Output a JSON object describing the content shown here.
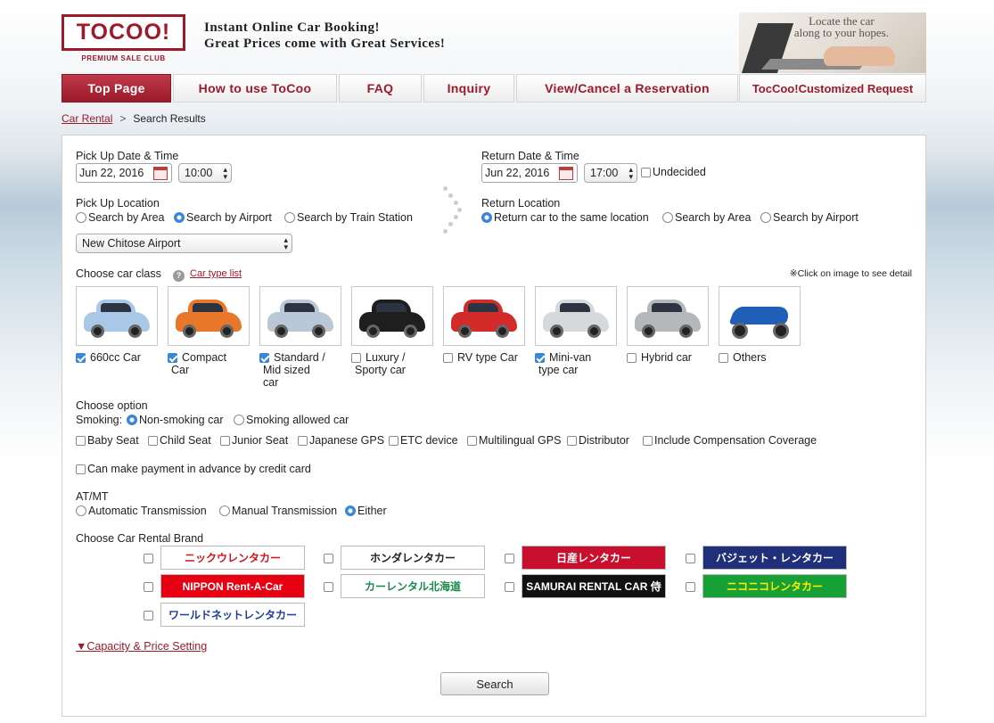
{
  "header": {
    "logo_text": "TOCOO!",
    "logo_sub": "PREMIUM SALE CLUB",
    "tagline_line1": "Instant Online Car Booking!",
    "tagline_line2": "Great Prices come with Great Services!",
    "banner_line1": "Locate the car",
    "banner_line2": "along to your hopes."
  },
  "nav": {
    "items": [
      {
        "label": "Top Page",
        "active": true
      },
      {
        "label": "How to use ToCoo"
      },
      {
        "label": "FAQ"
      },
      {
        "label": "Inquiry"
      },
      {
        "label": "View/Cancel a Reservation"
      }
    ],
    "right_label": "TocCoo!Customized Request"
  },
  "breadcrumb": {
    "link": "Car Rental",
    "separator": ">",
    "current": "Search Results"
  },
  "pickup": {
    "label": "Pick Up Date & Time",
    "date": "Jun 22, 2016",
    "time": "10:00",
    "location_label": "Pick Up Location",
    "options": [
      "Search by Area",
      "Search by Airport",
      "Search by Train Station"
    ],
    "selected_option": "Search by Airport",
    "airport": "New Chitose Airport"
  },
  "return": {
    "label": "Return Date & Time",
    "date": "Jun 22, 2016",
    "time": "17:00",
    "undecided_label": "Undecided",
    "undecided_checked": false,
    "location_label": "Return Location",
    "options": [
      "Return car to the same location",
      "Search by Area",
      "Search by Airport"
    ],
    "selected_option": "Return car to the same location"
  },
  "car_class": {
    "label": "Choose car class",
    "help_icon": "question-icon",
    "type_list_link": "Car type list",
    "note": "※Click on image to see detail",
    "classes": [
      {
        "label_lines": [
          "660cc Car"
        ],
        "checked": true,
        "color": "#a9c7e6"
      },
      {
        "label_lines": [
          "Compact",
          "Car"
        ],
        "checked": true,
        "color": "#e8772a"
      },
      {
        "label_lines": [
          "Standard /",
          "Mid sized",
          "car"
        ],
        "checked": true,
        "color": "#b9c7d6"
      },
      {
        "label_lines": [
          "Luxury /",
          "Sporty car"
        ],
        "checked": false,
        "color": "#1e1e1e"
      },
      {
        "label_lines": [
          "RV type Car"
        ],
        "checked": false,
        "color": "#d32a2a"
      },
      {
        "label_lines": [
          "Mini-van",
          "type car"
        ],
        "checked": true,
        "color": "#d6d9dc"
      },
      {
        "label_lines": [
          "Hybrid car"
        ],
        "checked": false,
        "color": "#b5b8bb"
      },
      {
        "label_lines": [
          "Others"
        ],
        "checked": false,
        "color": "#1f5fb8"
      }
    ]
  },
  "options": {
    "label": "Choose option",
    "smoking_label": "Smoking:",
    "smoking_options": [
      "Non-smoking car",
      "Smoking allowed car"
    ],
    "smoking_selected": "Non-smoking car",
    "extras": [
      "Baby Seat",
      "Child Seat",
      "Junior Seat",
      "Japanese GPS",
      "ETC device",
      "Multilingual GPS",
      "Distributor",
      "Include Compensation Coverage"
    ],
    "advance_payment": "Can make payment in advance by credit card"
  },
  "transmission": {
    "label": "AT/MT",
    "options": [
      "Automatic Transmission",
      "Manual Transmission",
      "Either"
    ],
    "selected": "Either"
  },
  "brands": {
    "label": "Choose Car Rental Brand",
    "items": [
      {
        "name": "ニックウレンタカー",
        "bg": "#ffffff",
        "fg": "#d8121b"
      },
      {
        "name": "ホンダレンタカー",
        "bg": "#ffffff",
        "fg": "#222222"
      },
      {
        "name": "日産レンタカー",
        "bg": "#c8102e",
        "fg": "#ffffff"
      },
      {
        "name": "バジェット・レンタカー",
        "bg": "#1f2f7a",
        "fg": "#ffffff"
      },
      {
        "name": "NIPPON Rent-A-Car",
        "bg": "#e60012",
        "fg": "#ffffff"
      },
      {
        "name": "カーレンタル北海道",
        "bg": "#ffffff",
        "fg": "#1a8b4c"
      },
      {
        "name": "SAMURAI RENTAL CAR 侍",
        "bg": "#111111",
        "fg": "#ffffff"
      },
      {
        "name": "ニコニコレンタカー",
        "bg": "#16a035",
        "fg": "#ffec00"
      },
      {
        "name": "ワールドネットレンタカー",
        "bg": "#ffffff",
        "fg": "#1f3d9a"
      }
    ]
  },
  "capacity_link": "▼Capacity & Price Setting",
  "search_button": "Search"
}
